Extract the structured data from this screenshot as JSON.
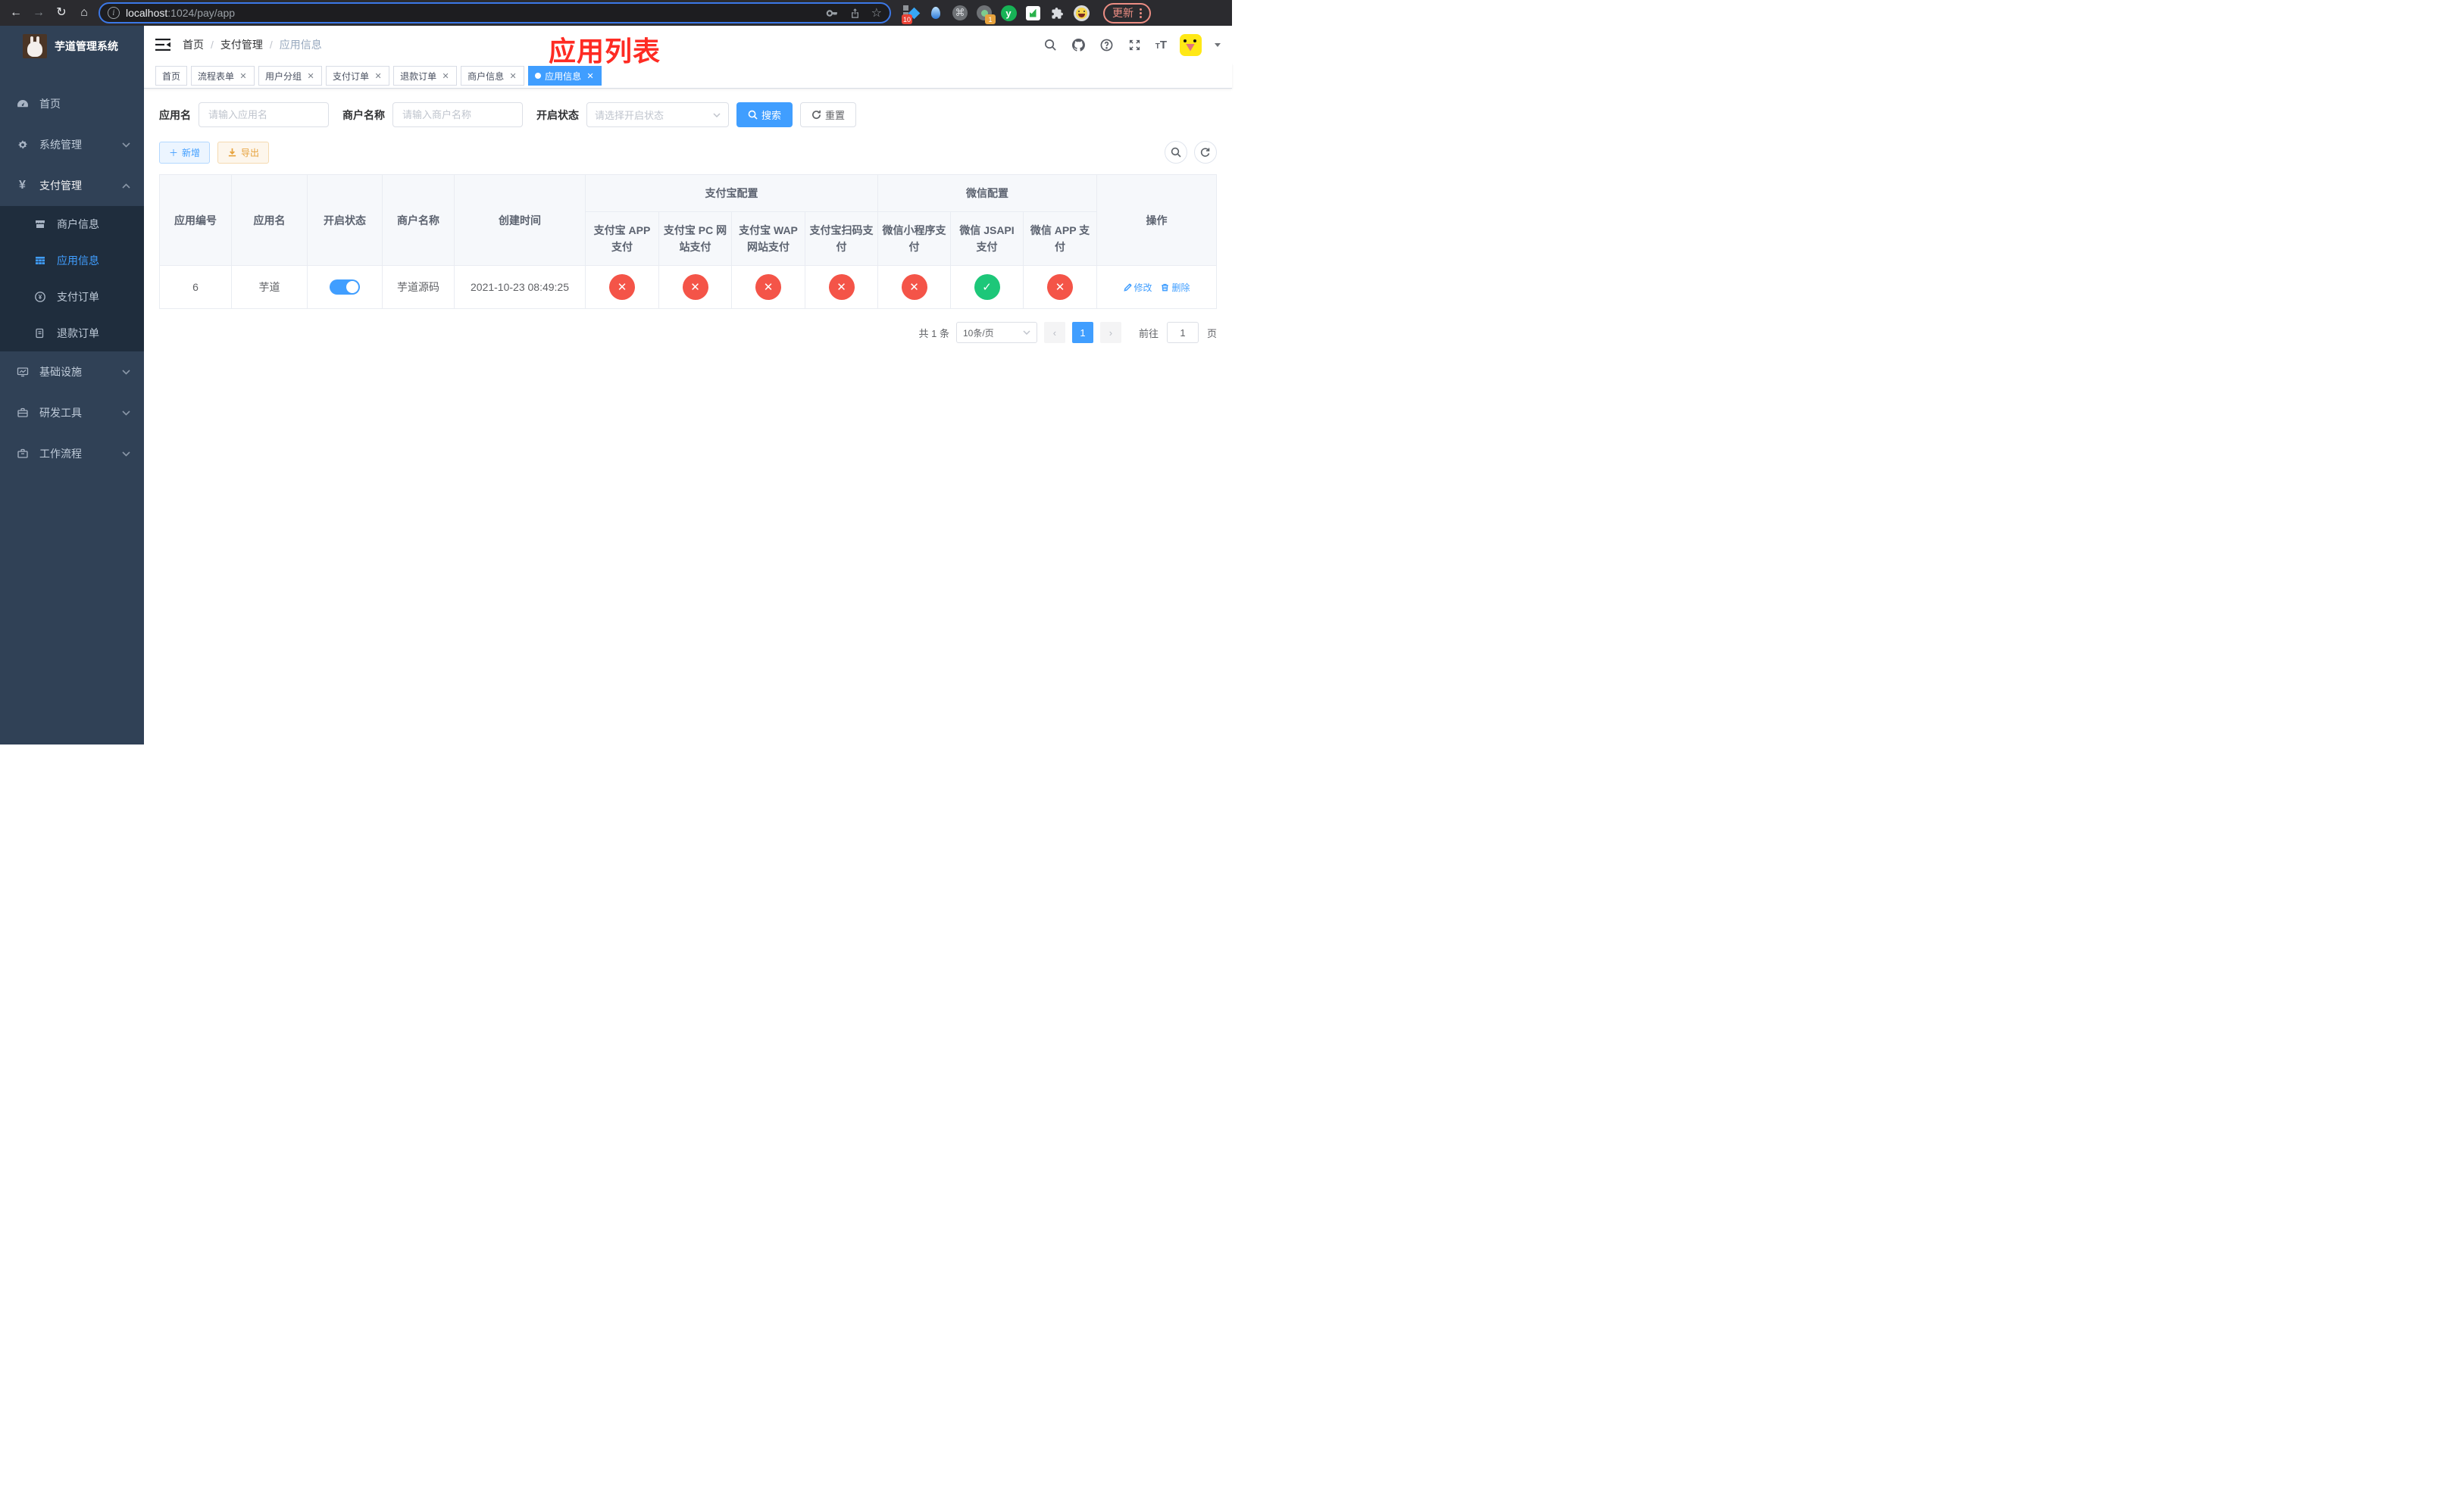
{
  "browser": {
    "url_host": "localhost",
    "url_rest": ":1024/pay/app",
    "update_label": "更新",
    "ext_badge_blue_diamond": "10",
    "ext_badge_profile": "1",
    "ext_y_letter": "y",
    "ext_cmd_symbol": "⌘"
  },
  "sidebar": {
    "title": "芋道管理系统",
    "items": [
      {
        "label": "首页"
      },
      {
        "label": "系统管理"
      },
      {
        "label": "支付管理"
      },
      {
        "label": "基础设施"
      },
      {
        "label": "研发工具"
      },
      {
        "label": "工作流程"
      }
    ],
    "pay_submenu": [
      {
        "label": "商户信息"
      },
      {
        "label": "应用信息"
      },
      {
        "label": "支付订单"
      },
      {
        "label": "退款订单"
      }
    ]
  },
  "navbar": {
    "breadcrumb": [
      "首页",
      "支付管理",
      "应用信息"
    ]
  },
  "annotation": "应用列表",
  "tabs": [
    {
      "label": "首页"
    },
    {
      "label": "流程表单"
    },
    {
      "label": "用户分组"
    },
    {
      "label": "支付订单"
    },
    {
      "label": "退款订单"
    },
    {
      "label": "商户信息"
    },
    {
      "label": "应用信息"
    }
  ],
  "filters": {
    "app_name_label": "应用名",
    "app_name_placeholder": "请输入应用名",
    "merchant_label": "商户名称",
    "merchant_placeholder": "请输入商户名称",
    "status_label": "开启状态",
    "status_placeholder": "请选择开启状态",
    "search_label": "搜索",
    "reset_label": "重置"
  },
  "toolbar": {
    "add_label": "新增",
    "export_label": "导出"
  },
  "table": {
    "main_headers": [
      "应用编号",
      "应用名",
      "开启状态",
      "商户名称",
      "创建时间"
    ],
    "group_headers": [
      {
        "label": "支付宝配置"
      },
      {
        "label": "微信配置"
      }
    ],
    "sub_headers": [
      "支付宝 APP 支付",
      "支付宝 PC 网站支付",
      "支付宝 WAP 网站支付",
      "支付宝扫码支付",
      "微信小程序支付",
      "微信 JSAPI 支付",
      "微信 APP 支付"
    ],
    "ops_header": "操作",
    "rows": [
      {
        "id": "6",
        "name": "芋道",
        "enabled": true,
        "merchant": "芋道源码",
        "created": "2021-10-23 08:49:25",
        "statuses": [
          "no",
          "no",
          "no",
          "no",
          "no",
          "yes",
          "no"
        ],
        "edit_label": "修改",
        "delete_label": "删除"
      }
    ]
  },
  "pagination": {
    "total_text": "共 1 条",
    "page_size": "10条/页",
    "current_page": "1",
    "goto_label": "前往",
    "goto_value": "1",
    "page_unit": "页"
  },
  "colors": {
    "accent": "#409eff",
    "danger": "#f45448",
    "success": "#1dc779",
    "sidebar_bg": "#304156",
    "submenu_bg": "#1f2d3d",
    "annotation_red": "#fe2b23"
  }
}
